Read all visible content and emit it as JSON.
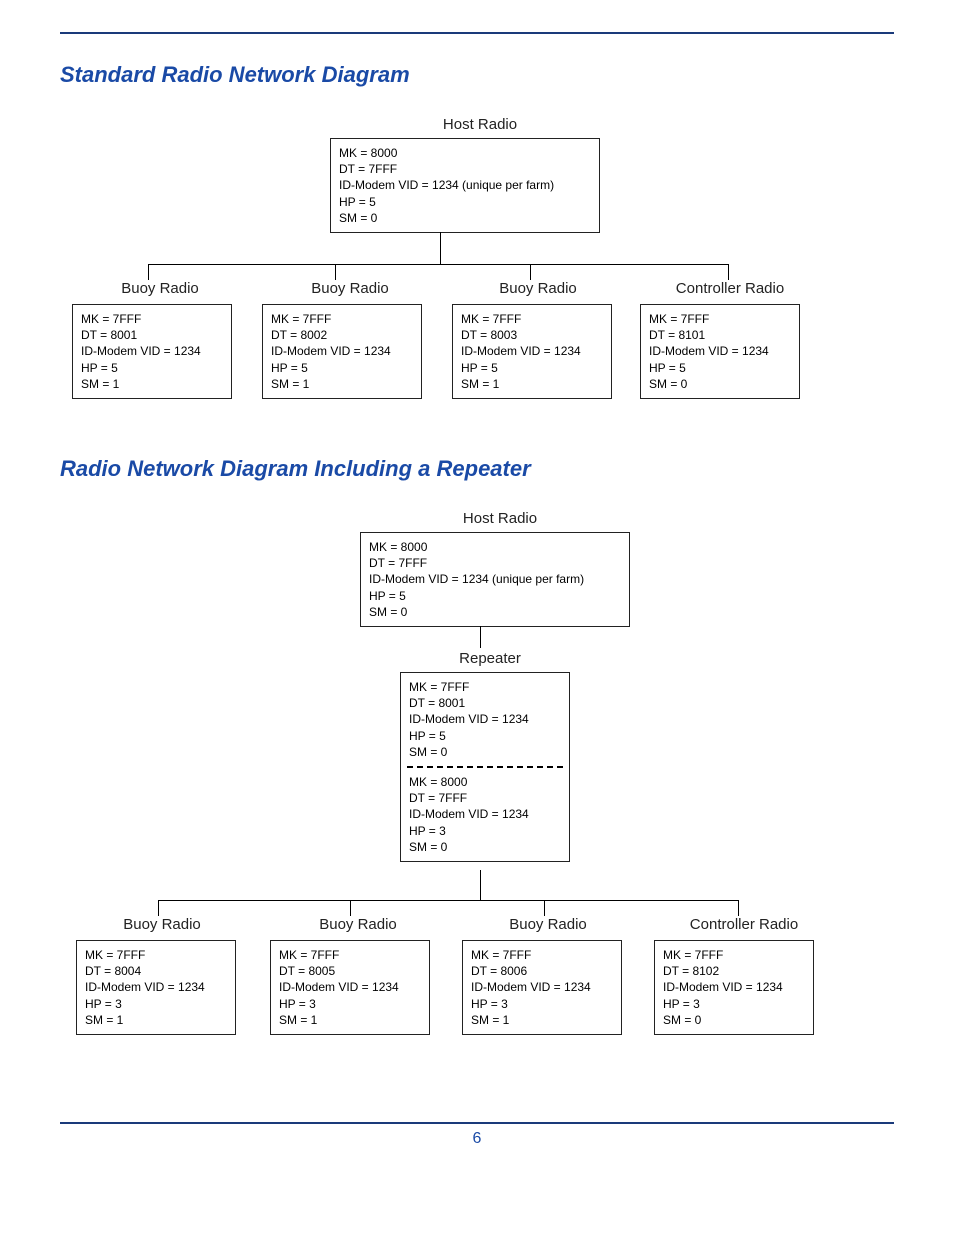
{
  "headings": {
    "diagram1": "Standard Radio Network Diagram",
    "diagram2": "Radio Network Diagram Including a Repeater"
  },
  "page_number": "6",
  "diagram1": {
    "host": {
      "label": "Host Radio",
      "mk": "MK = 8000",
      "dt": "DT = 7FFF",
      "id": "ID-Modem VID = 1234 (unique per farm)",
      "hp": "HP = 5",
      "sm": "SM = 0"
    },
    "children": [
      {
        "label": "Buoy Radio",
        "mk": "MK = 7FFF",
        "dt": "DT = 8001",
        "id": "ID-Modem VID = 1234",
        "hp": "HP = 5",
        "sm": "SM = 1"
      },
      {
        "label": "Buoy Radio",
        "mk": "MK = 7FFF",
        "dt": "DT = 8002",
        "id": "ID-Modem VID = 1234",
        "hp": "HP = 5",
        "sm": "SM = 1"
      },
      {
        "label": "Buoy Radio",
        "mk": "MK = 7FFF",
        "dt": "DT = 8003",
        "id": "ID-Modem VID = 1234",
        "hp": "HP = 5",
        "sm": "SM = 1"
      },
      {
        "label": "Controller Radio",
        "mk": "MK = 7FFF",
        "dt": "DT = 8101",
        "id": "ID-Modem VID = 1234",
        "hp": "HP = 5",
        "sm": "SM = 0"
      }
    ]
  },
  "diagram2": {
    "host": {
      "label": "Host Radio",
      "mk": "MK = 8000",
      "dt": "DT = 7FFF",
      "id": "ID-Modem VID = 1234 (unique per farm)",
      "hp": "HP = 5",
      "sm": "SM = 0"
    },
    "repeater": {
      "label": "Repeater",
      "top": {
        "mk": "MK = 7FFF",
        "dt": "DT = 8001",
        "id": "ID-Modem VID = 1234",
        "hp": "HP = 5",
        "sm": "SM = 0"
      },
      "bot": {
        "mk": "MK = 8000",
        "dt": "DT = 7FFF",
        "id": "ID-Modem VID = 1234",
        "hp": "HP = 3",
        "sm": "SM = 0"
      }
    },
    "children": [
      {
        "label": "Buoy Radio",
        "mk": "MK = 7FFF",
        "dt": "DT = 8004",
        "id": "ID-Modem VID = 1234",
        "hp": "HP = 3",
        "sm": "SM = 1"
      },
      {
        "label": "Buoy Radio",
        "mk": "MK = 7FFF",
        "dt": "DT = 8005",
        "id": "ID-Modem VID = 1234",
        "hp": "HP = 3",
        "sm": "SM = 1"
      },
      {
        "label": "Buoy Radio",
        "mk": "MK = 7FFF",
        "dt": "DT = 8006",
        "id": "ID-Modem VID = 1234",
        "hp": "HP = 3",
        "sm": "SM = 1"
      },
      {
        "label": "Controller Radio",
        "mk": "MK = 7FFF",
        "dt": "DT = 8102",
        "id": "ID-Modem VID = 1234",
        "hp": "HP = 3",
        "sm": "SM = 0"
      }
    ]
  }
}
